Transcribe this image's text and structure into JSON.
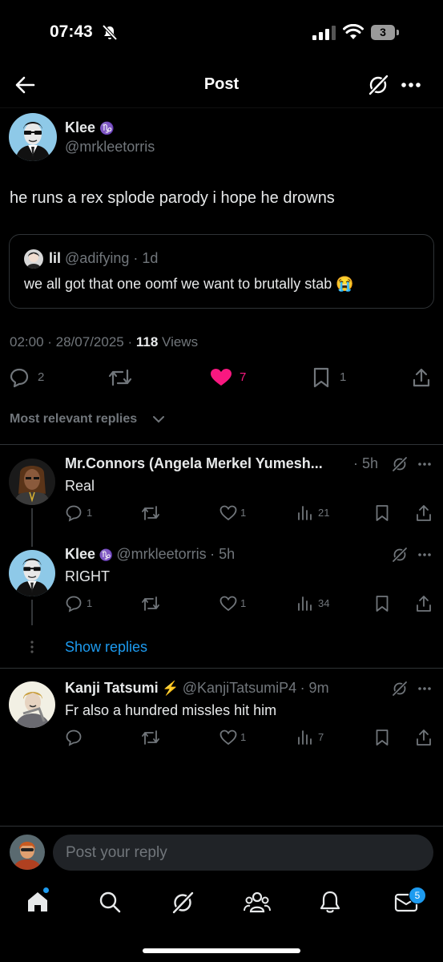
{
  "status_bar": {
    "time": "07:43",
    "battery": "3"
  },
  "header": {
    "title": "Post"
  },
  "post": {
    "author_name": "Klee",
    "author_badge": "♑",
    "author_handle": "@mrkleetorris",
    "text": "he runs a rex splode parody i hope he drowns",
    "quote": {
      "name": "lil",
      "handle": "@adifying",
      "age": "· 1d",
      "text": "we all got that one oomf we want to brutally stab 😭"
    },
    "time": "02:00 · 28/07/2025 ·",
    "views_count": "118",
    "views_label": "Views",
    "replies": "2",
    "likes": "7",
    "bookmarks": "1"
  },
  "colors": {
    "like": "#f91880",
    "link": "#1d9bf0",
    "background": "#000000"
  },
  "sort_label": "Most relevant replies",
  "replies": [
    {
      "name": "Mr.Connors (Angela Merkel Yumesh...",
      "age": "· 5h",
      "text": "Real",
      "comments": "1",
      "likes": "1",
      "views": "21"
    },
    {
      "name": "Klee",
      "badge": "♑",
      "handle": "@mrkleetorris",
      "age": "· 5h",
      "text": "RIGHT",
      "comments": "1",
      "likes": "1",
      "views": "34"
    },
    {
      "name": "Kanji Tatsumi",
      "badge": "⚡",
      "handle": "@KanjiTatsumiP4",
      "age": "· 9m",
      "text": "Fr also a hundred missles hit him",
      "likes": "1",
      "views": "7"
    }
  ],
  "show_replies": "Show replies",
  "reply_bar": {
    "placeholder": "Post your reply"
  },
  "tab_bar": {
    "icons": [
      "home-icon",
      "search-icon",
      "grok-icon",
      "communities-icon",
      "notifications-icon",
      "messages-icon"
    ],
    "messages_badge": "5"
  }
}
